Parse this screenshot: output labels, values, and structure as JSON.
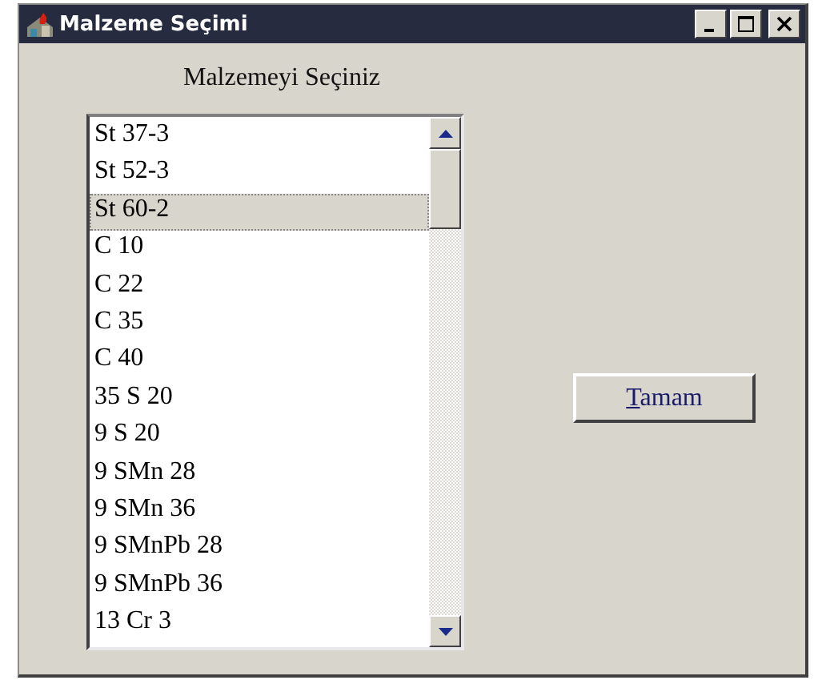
{
  "window": {
    "title": "Malzeme Seçimi"
  },
  "prompt": "Malzemeyi Seçiniz",
  "list": {
    "items": [
      {
        "label": "St 37-3",
        "selected": false
      },
      {
        "label": "St 52-3",
        "selected": false
      },
      {
        "label": "St 60-2",
        "selected": true
      },
      {
        "label": "C 10",
        "selected": false
      },
      {
        "label": "C 22",
        "selected": false
      },
      {
        "label": "C 35",
        "selected": false
      },
      {
        "label": "C 40",
        "selected": false
      },
      {
        "label": "35 S 20",
        "selected": false
      },
      {
        "label": "9 S 20",
        "selected": false
      },
      {
        "label": "9 SMn 28",
        "selected": false
      },
      {
        "label": "9 SMn 36",
        "selected": false
      },
      {
        "label": "9 SMnPb 28",
        "selected": false
      },
      {
        "label": "9 SMnPb 36",
        "selected": false
      },
      {
        "label": "13 Cr 3",
        "selected": false
      }
    ]
  },
  "button": {
    "label": "Tamam"
  }
}
